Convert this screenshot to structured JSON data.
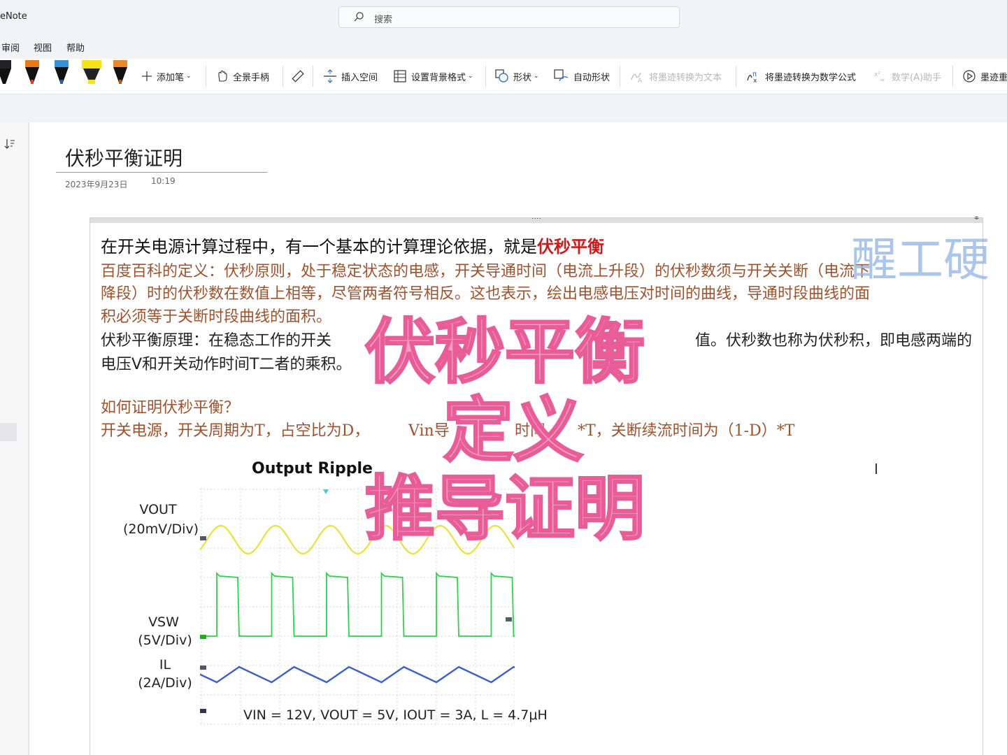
{
  "app": {
    "name": "eNote"
  },
  "search": {
    "placeholder": "搜索"
  },
  "menu": {
    "items": [
      "审阅",
      "视图",
      "帮助"
    ]
  },
  "ribbon": {
    "add_pen": "添加笔",
    "lasso": "全景手柄",
    "insert_space": "插入空间",
    "background": "设置背景格式",
    "shapes": "形状",
    "auto_shapes": "自动形状",
    "ink_to_text": "将墨迹转换为文本",
    "ink_to_math": "将墨迹转换为数学公式",
    "math_assistant": "数学(A)助手",
    "ink_replay": "墨迹重"
  },
  "page": {
    "title": "伏秒平衡证明",
    "date": "2023年9月23日",
    "time": "10:19"
  },
  "note": {
    "line1_prefix": "在开关电源计算过程中，有一个基本的计算理论依据，就是",
    "line1_highlight": "伏秒平衡",
    "line2": "百度百科的定义：伏秒原则，处于稳定状态的电感，开关导通时间（电流上升段）的伏秒数须与开关关断（电流下",
    "line3": "降段）时的伏秒数在数值上相等，尽管两者符号相反。这也表示，绘出电感电压对时间的曲线，导通时段曲线的面",
    "line4": "积必须等于关断时段曲线的面积。",
    "line5a": "伏秒平衡原理：在稳态工作的开关",
    "line5b": "值。伏秒数也称为伏秒积，即电感两端的",
    "line6": "电压V和开关动作时间T二者的乘积。",
    "line7": "如何证明伏秒平衡？",
    "line8a": "开关电源，开关周期为T，占空比为D，",
    "line8b": "Vin导",
    "line8c": "时间",
    "line8d": "*T，关断续流时间为（1-D）*T"
  },
  "overlay": {
    "line1": "伏秒平衡",
    "line2": "定义",
    "line3": "推导证明",
    "watermark": "醒工硬"
  },
  "scope": {
    "title": "Output Ripple",
    "vout_label": "VOUT",
    "vout_scale": "(20mV/Div)",
    "vsw_label": "VSW",
    "vsw_scale": "(5V/Div)",
    "il_label": "IL",
    "il_scale": "(2A/Div)",
    "caption": "VIN = 12V, VOUT = 5V, IOUT = 3A, L = 4.7μH"
  },
  "icons": [
    "search-icon",
    "pen-icon",
    "plus-icon",
    "hand-icon",
    "ruler-icon",
    "insert-space-icon",
    "background-icon",
    "shapes-icon",
    "auto-shapes-icon",
    "ink-text-icon",
    "ink-math-icon",
    "math-assistant-icon",
    "replay-icon",
    "sort-icon"
  ],
  "colors": {
    "highlight": "#cc1a1a",
    "overlay": "#f7a0c4",
    "watermark": "#8fb4e2",
    "trace_yellow": "#e8e23a",
    "trace_green": "#2fd24a",
    "trace_blue": "#3a5fcf"
  }
}
